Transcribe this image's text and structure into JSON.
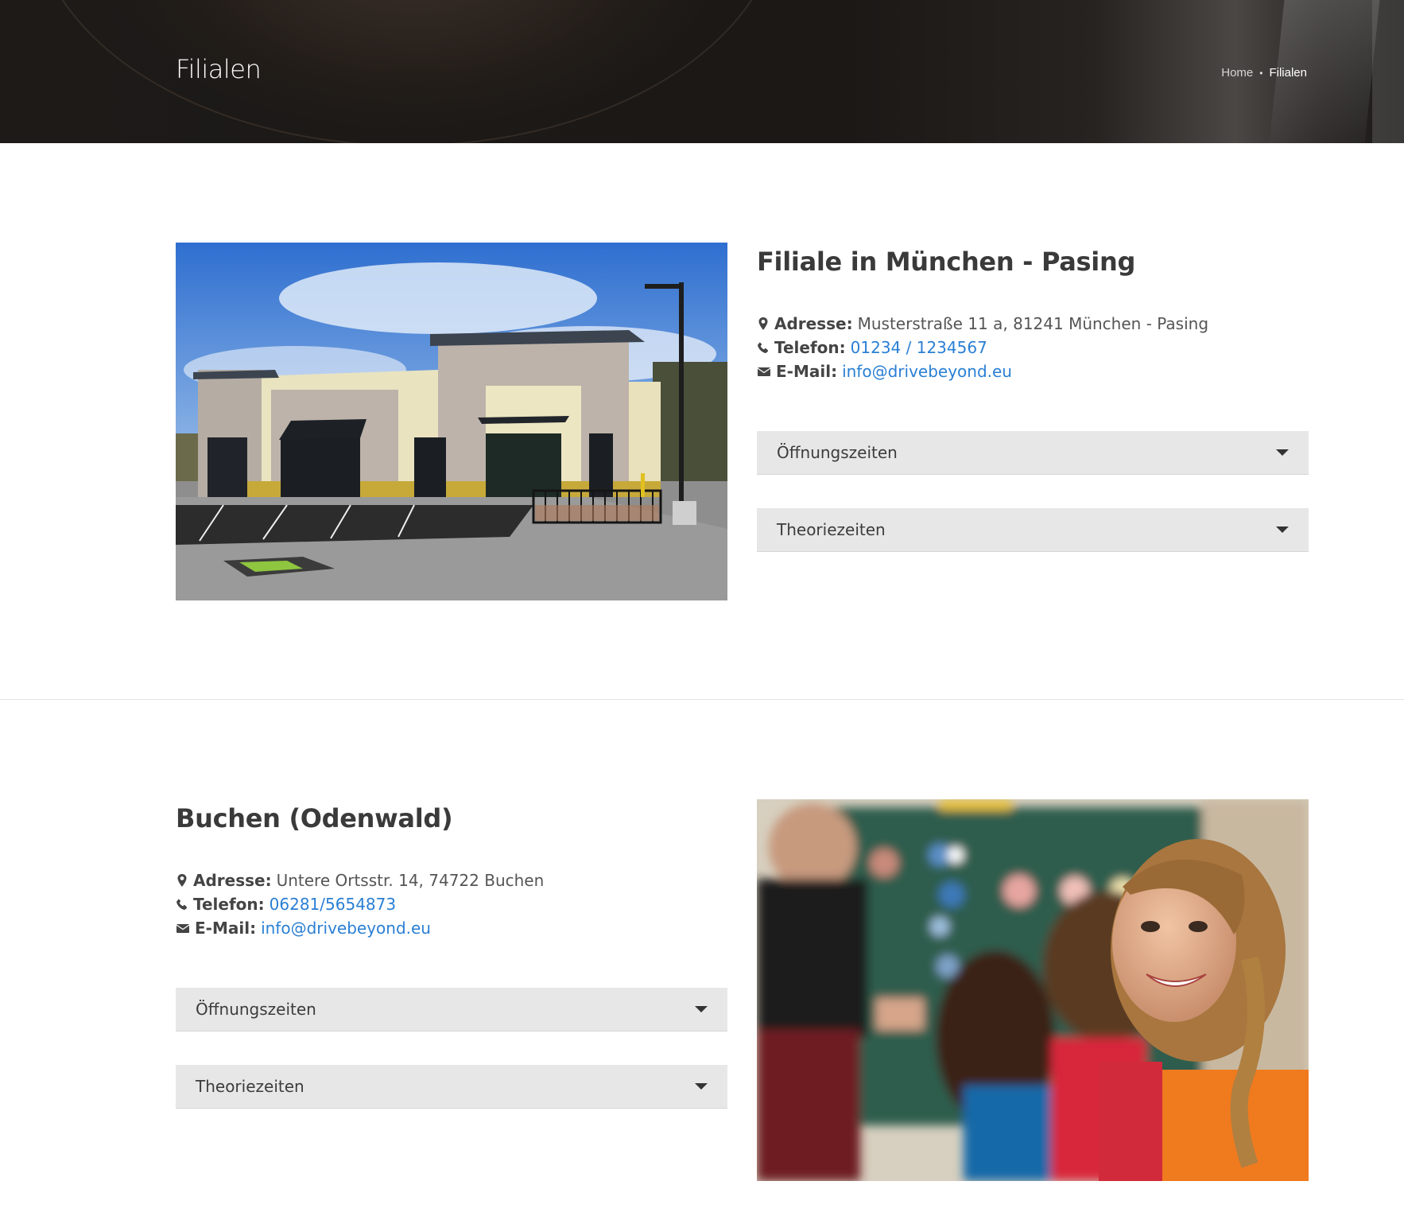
{
  "header": {
    "title": "Filialen",
    "breadcrumb": {
      "home": "Home",
      "separator": "•",
      "current": "Filialen"
    }
  },
  "branches": [
    {
      "title": "Filiale in München - Pasing",
      "address_label": "Adresse:",
      "address": "Musterstraße 11 a, 81241 München - Pasing",
      "phone_label": "Telefon:",
      "phone": "01234 / 1234567",
      "email_label": "E-Mail:",
      "email": "info@drivebeyond.eu",
      "accordion": [
        "Öffnungszeiten",
        "Theoriezeiten"
      ]
    },
    {
      "title": "Buchen (Odenwald)",
      "address_label": "Adresse:",
      "address": "Untere Ortsstr. 14, 74722 Buchen",
      "phone_label": "Telefon:",
      "phone": "06281/5654873",
      "email_label": "E-Mail:",
      "email": "info@drivebeyond.eu",
      "accordion": [
        "Öffnungszeiten",
        "Theoriezeiten"
      ]
    }
  ],
  "colors": {
    "link": "#2a7fd4",
    "accordion_bg": "#e7e7e7"
  },
  "icons": [
    "map-marker-icon",
    "phone-icon",
    "envelope-icon",
    "caret-down-icon"
  ]
}
